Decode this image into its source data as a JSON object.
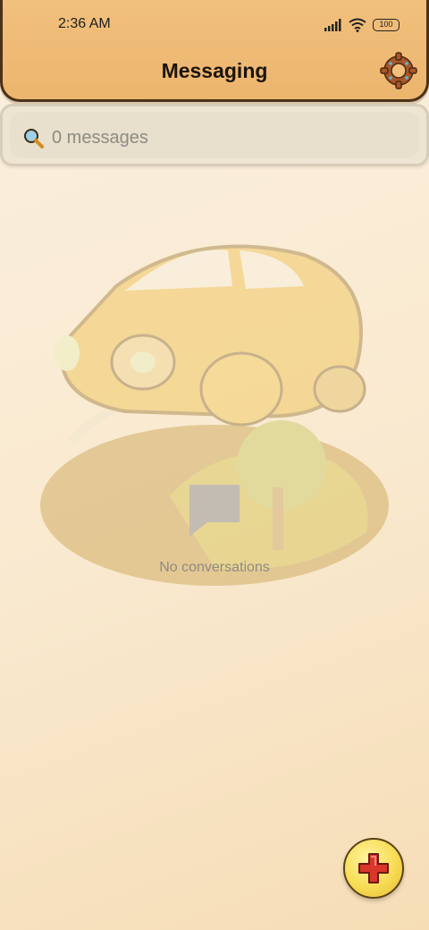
{
  "status_bar": {
    "time": "2:36 AM",
    "battery": "100",
    "icons": [
      "signal-icon",
      "wifi-icon",
      "battery-icon"
    ]
  },
  "header": {
    "title": "Messaging",
    "settings_icon": "gear-icon"
  },
  "search": {
    "placeholder": "0 messages",
    "icon": "search-icon"
  },
  "empty_state": {
    "icon": "chat-bubble-icon",
    "text": "No conversations",
    "background_illustration": "car-on-hill-illustration"
  },
  "fab": {
    "icon": "plus-icon"
  },
  "colors": {
    "header": "#ecb56e",
    "header_border": "#4a3118",
    "background": "#fbf0de",
    "fab": "#f7dc54",
    "plus": "#d9362c"
  }
}
